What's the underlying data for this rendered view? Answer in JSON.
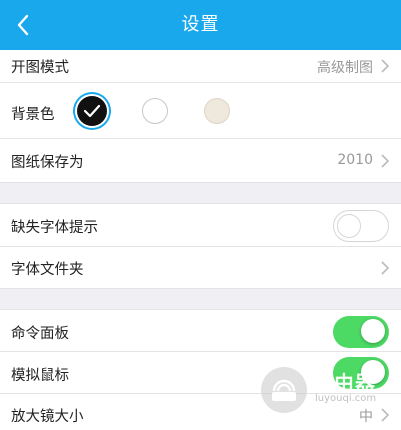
{
  "header": {
    "title": "设置",
    "back_icon": "chevron-left-icon"
  },
  "open_mode": {
    "label": "开图模式",
    "value": "高级制图"
  },
  "background": {
    "label": "背景色",
    "options": [
      "black",
      "white",
      "cream"
    ],
    "selected": "black",
    "colors": {
      "black": "#111111",
      "white": "#ffffff",
      "cream": "#efe9dd"
    }
  },
  "save_as": {
    "label": "图纸保存为",
    "value": "2010"
  },
  "missing_font": {
    "label": "缺失字体提示",
    "enabled": false
  },
  "font_folder": {
    "label": "字体文件夹"
  },
  "command_panel": {
    "label": "命令面板",
    "enabled": true
  },
  "sim_mouse": {
    "label": "模拟鼠标",
    "enabled": true
  },
  "magnifier": {
    "label": "放大镜大小",
    "value": "中"
  },
  "watermark": {
    "brand": "路由器",
    "domain": "luyouqi.com"
  },
  "colors": {
    "accent": "#19a8ec",
    "toggle_on": "#4cd964",
    "background": "#efeff4"
  }
}
